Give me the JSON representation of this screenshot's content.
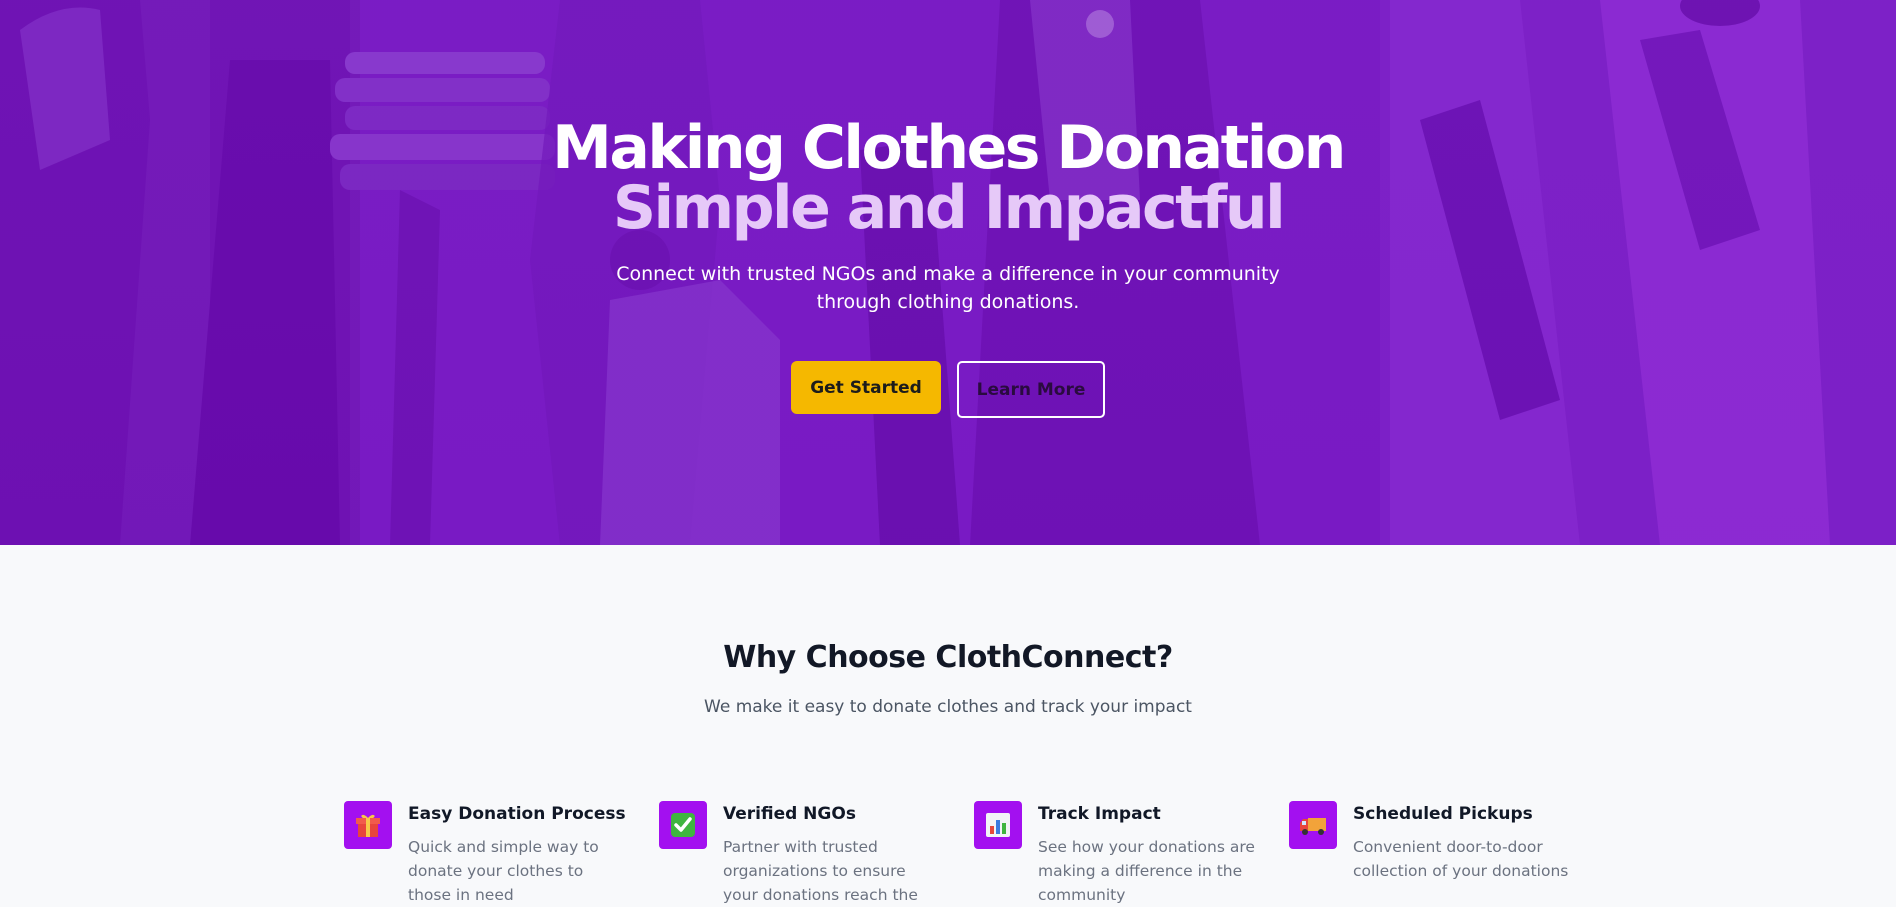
{
  "hero": {
    "title_line1": "Making Clothes Donation",
    "title_line2": "Simple and Impactful",
    "subtitle": "Connect with trusted NGOs and make a difference in your community through clothing donations.",
    "primary_button": "Get Started",
    "secondary_button": "Learn More"
  },
  "why": {
    "title": "Why Choose ClothConnect?",
    "subtitle": "We make it easy to donate clothes and track your impact",
    "features": [
      {
        "icon": "gift-icon",
        "title": "Easy Donation Process",
        "description": "Quick and simple way to donate your clothes to those in need"
      },
      {
        "icon": "check-icon",
        "title": "Verified NGOs",
        "description": "Partner with trusted organizations to ensure your donations reach the"
      },
      {
        "icon": "chart-icon",
        "title": "Track Impact",
        "description": "See how your donations are making a difference in the community"
      },
      {
        "icon": "truck-icon",
        "title": "Scheduled Pickups",
        "description": "Convenient door-to-door collection of your donations"
      }
    ]
  },
  "colors": {
    "hero_bg": "#7718c4",
    "accent_yellow": "#f5b800",
    "title_highlight": "#e6c9f8",
    "icon_bg": "#a310f0"
  }
}
